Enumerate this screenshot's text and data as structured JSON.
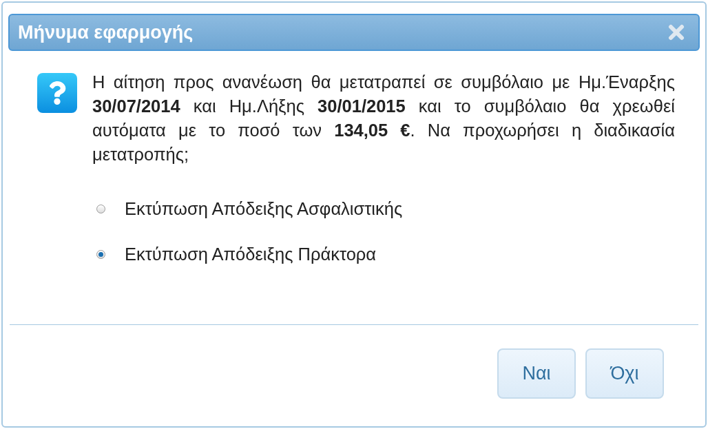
{
  "dialog": {
    "title": "Μήνυμα εφαρμογής",
    "message": "Η αίτηση προς ανανέωση θα μετατραπεί σε συμβόλαιο με Ημ.Έναρξης **30/07/2014** και Ημ.Λήξης **30/01/2015** και το συμβόλαιο θα χρεωθεί αυτόματα με το ποσό των **134,05 €**. Να προχωρήσει η διαδικασία μετατροπής;",
    "options": [
      {
        "label": "Εκτύπωση Απόδειξης Ασφαλιστικής",
        "selected": false
      },
      {
        "label": "Εκτύπωση Απόδειξης Πράκτορα",
        "selected": true
      }
    ],
    "buttons": [
      "Ναι",
      "Όχι"
    ]
  }
}
